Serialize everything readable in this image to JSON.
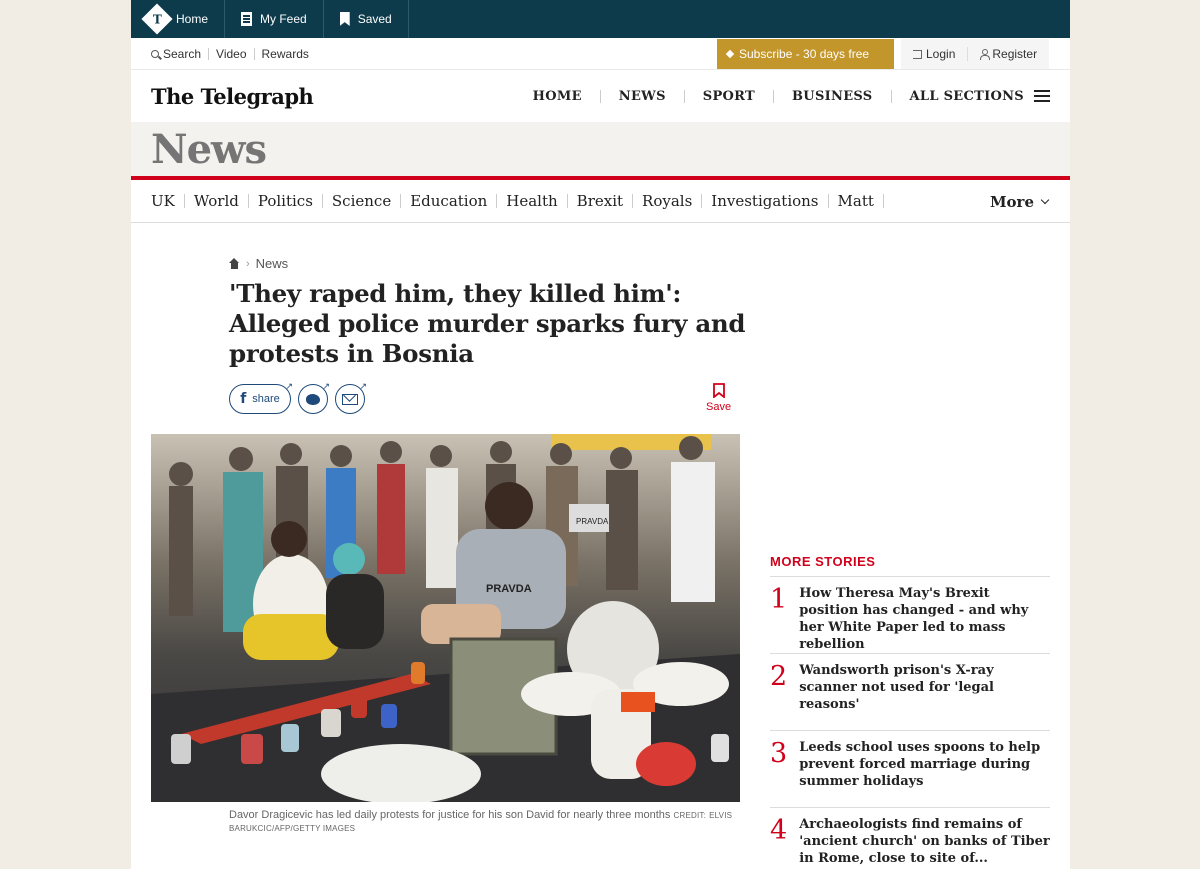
{
  "topbar": {
    "items": [
      {
        "label": "Home"
      },
      {
        "label": "My Feed"
      },
      {
        "label": "Saved"
      }
    ]
  },
  "utility": {
    "links": [
      "Search",
      "Video",
      "Rewards"
    ],
    "subscribe": "Subscribe - 30 days free",
    "login": "Login",
    "register": "Register"
  },
  "masthead": {
    "logo": "The Telegraph",
    "nav": [
      "HOME",
      "NEWS",
      "SPORT",
      "BUSINESS",
      "ALL SECTIONS"
    ]
  },
  "section": {
    "title": "News"
  },
  "subnav": {
    "items": [
      "UK",
      "World",
      "Politics",
      "Science",
      "Education",
      "Health",
      "Brexit",
      "Royals",
      "Investigations",
      "Matt"
    ],
    "more": "More"
  },
  "article": {
    "breadcrumb": "News",
    "headline": "'They raped him, they killed him': Alleged police murder sparks fury and protests in Bosnia",
    "share_label": "share",
    "save_label": "Save",
    "caption": "Davor Dragicevic has led daily protests for justice for his son David for nearly three months",
    "credit_label": "CREDIT:",
    "credit": "ELVIS BARUKCIC/AFP/GETTY IMAGES",
    "photo_texts": {
      "shirt": "PRAVDA",
      "sign": "PRAVDA"
    }
  },
  "more_stories": {
    "title": "MORE STORIES",
    "items": [
      {
        "num": "1",
        "text": "How Theresa May's Brexit position has changed - and why her White Paper led to mass rebellion"
      },
      {
        "num": "2",
        "text": "Wandsworth prison's X-ray scanner not used for 'legal reasons'"
      },
      {
        "num": "3",
        "text": "Leeds school uses spoons to help prevent forced marriage during summer holidays"
      },
      {
        "num": "4",
        "text": "Archaeologists find remains of 'ancient church' on banks of Tiber in Rome, close to site of..."
      }
    ]
  },
  "colors": {
    "topbar": "#0d3b4c",
    "accent_red": "#d0021b",
    "subscribe_gold": "#c3962b"
  }
}
